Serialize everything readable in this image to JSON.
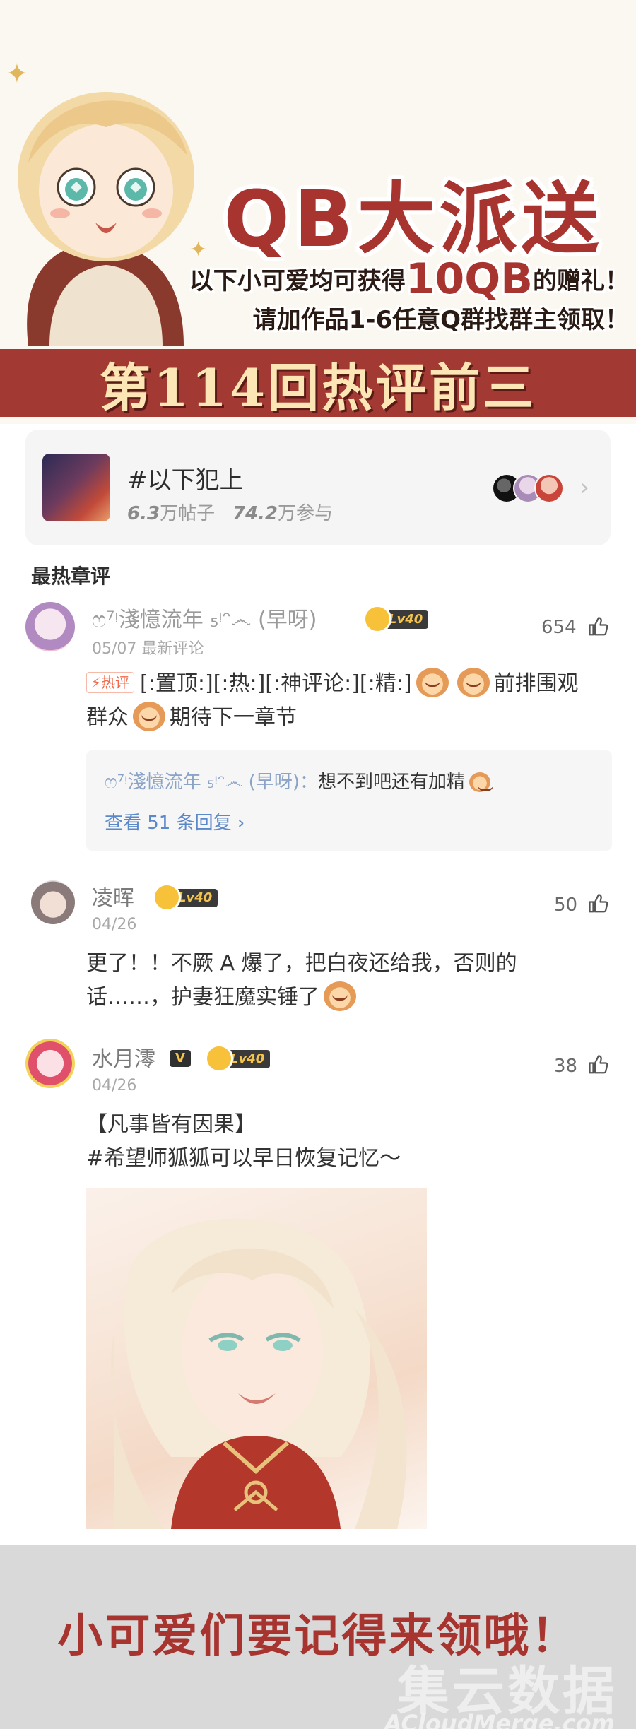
{
  "banner": {
    "title": "QB大派送",
    "promo_prefix": "以下小可爱均可获得",
    "promo_amount": "10QB",
    "promo_suffix": "的赠礼！",
    "promo_line2": "请加作品1-6任意Q群找群主领取！",
    "ribbon": "第114回热评前三"
  },
  "topic": {
    "name": "#以下犯上",
    "posts_value": "6.3",
    "posts_unit": "万帖子",
    "participants_value": "74.2",
    "participants_unit": "万参与",
    "chevron": "›"
  },
  "section_title": "最热章评",
  "comments": [
    {
      "username": "ෆ⁷ᵎ淺憶流年 ₅ᵎᵔ෴ (早呀)",
      "level": "Lv40",
      "meta": "05/07 最新评论",
      "likes": "654",
      "hot_tag": "⚡热评",
      "text_part1": "[:置顶:][:热:][:神评论:][:精:]",
      "text_part2": "前排围观群众",
      "text_part3": "期待下一章节",
      "reply_user": "ෆ⁷ᵎ淺憶流年 ₅ᵎᵔ෴ (早呀)：",
      "reply_text": "想不到吧还有加精",
      "reply_more": "查看 51 条回复 ›"
    },
    {
      "username": "凌晖",
      "level": "Lv40",
      "meta": "04/26",
      "likes": "50",
      "text_line1": "更了！！不厥 A 爆了，把白夜还给我，否则的",
      "text_line2": "话……，护妻狂魔实锤了"
    },
    {
      "username": "水月澪",
      "verified": "V",
      "level": "Lv40",
      "meta": "04/26",
      "likes": "38",
      "text_line1": "【凡事皆有因果】",
      "text_line2": "#希望师狐狐可以早日恢复记忆～"
    }
  ],
  "footer": {
    "text": "小可爱们要记得来领哦！",
    "watermark_cn": "集云数据",
    "watermark_en": "ACloudMerge.com"
  },
  "colors": {
    "brand_red": "#a8342f",
    "ribbon_red": "#a23a33",
    "ribbon_text": "#fde6b6",
    "link_blue": "#5a88c9"
  },
  "icons": [
    "sparkle-icon",
    "thumb-up-icon",
    "chevron-right-icon",
    "level-badge-icon",
    "verified-icon"
  ]
}
